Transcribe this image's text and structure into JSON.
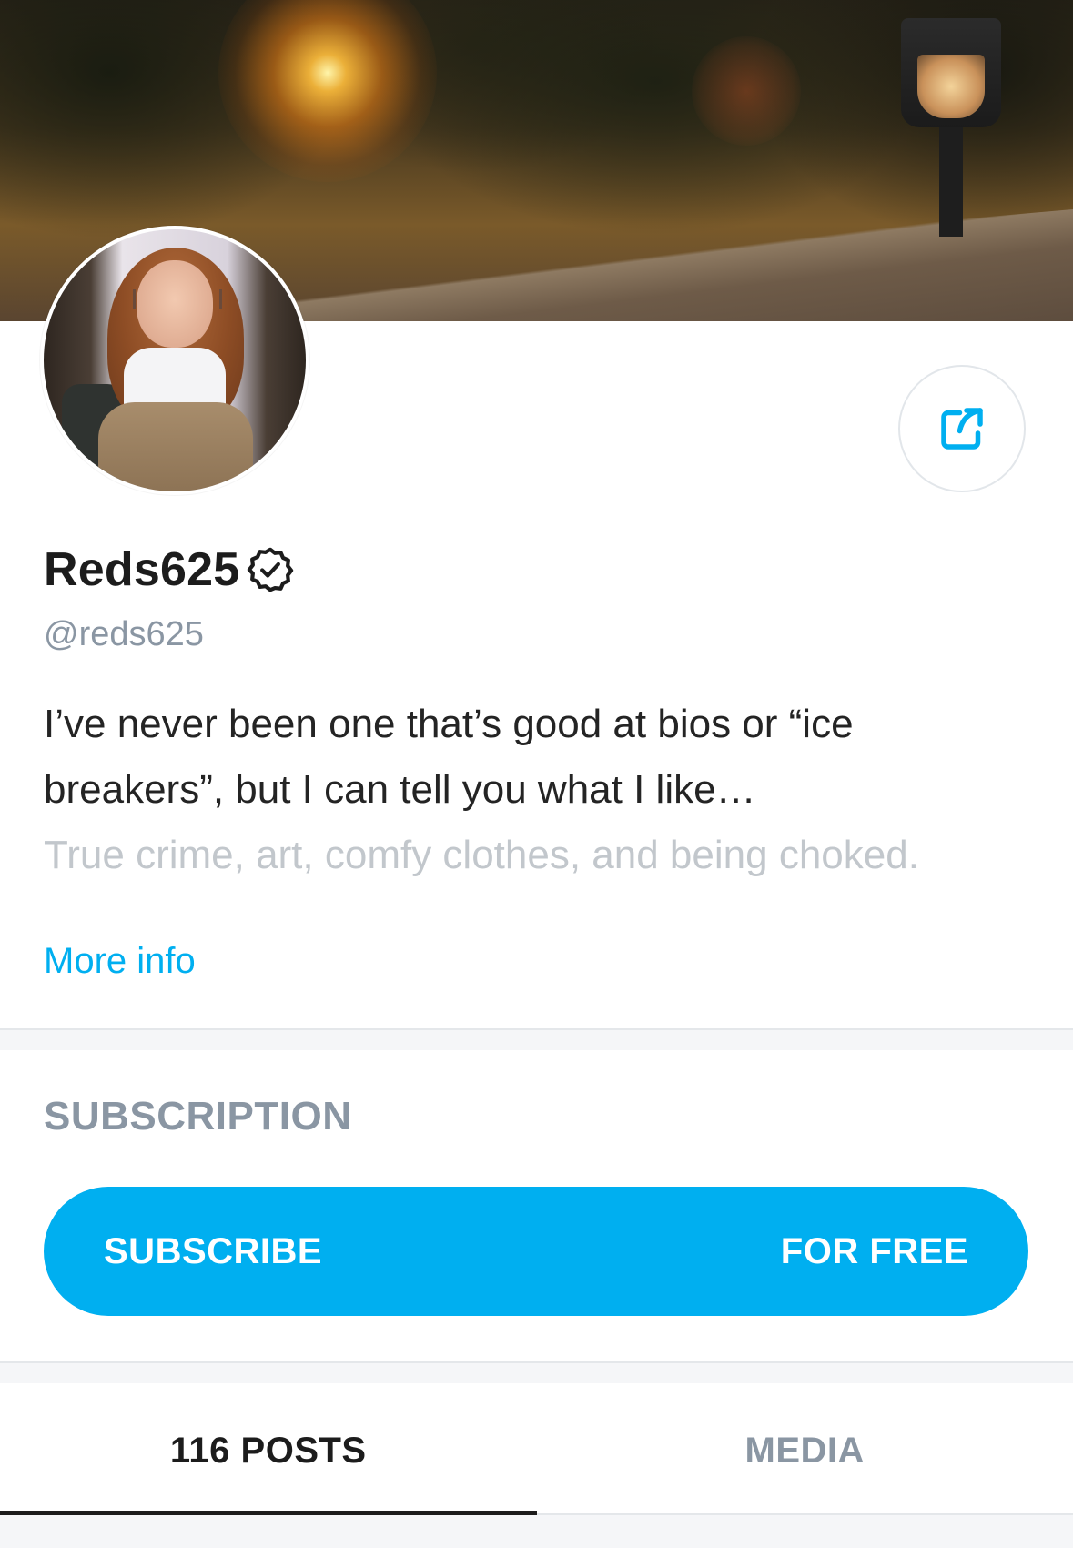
{
  "profile": {
    "display_name": "Reds625",
    "handle": "@reds625",
    "bio_line_1": "I’ve never been one that’s good at bios or “ice",
    "bio_line_2": "breakers”, but I can tell you what I like…",
    "bio_faded": "True crime, art, comfy clothes, and being choked.",
    "more_info_label": "More info",
    "verified_icon": "verified-badge-icon"
  },
  "subscription": {
    "section_title": "SUBSCRIPTION",
    "button_left_label": "SUBSCRIBE",
    "button_right_label": "FOR FREE"
  },
  "tabs": [
    {
      "label": "116 POSTS",
      "active": true
    },
    {
      "label": "MEDIA",
      "active": false
    }
  ],
  "icons": {
    "share": "share-icon"
  },
  "colors": {
    "accent": "#00aff0",
    "muted_text": "#8a96a3",
    "primary_text": "#1c1c1c"
  }
}
